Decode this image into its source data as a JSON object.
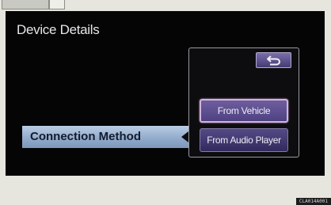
{
  "screen": {
    "title": "Device Details",
    "list_row_label": "Connection Method"
  },
  "popup": {
    "back_icon": "return-arrow-icon",
    "options": [
      {
        "label": "From Vehicle",
        "selected": true
      },
      {
        "label": "From Audio Player",
        "selected": false
      }
    ]
  },
  "figure_code": "CLA014A001"
}
